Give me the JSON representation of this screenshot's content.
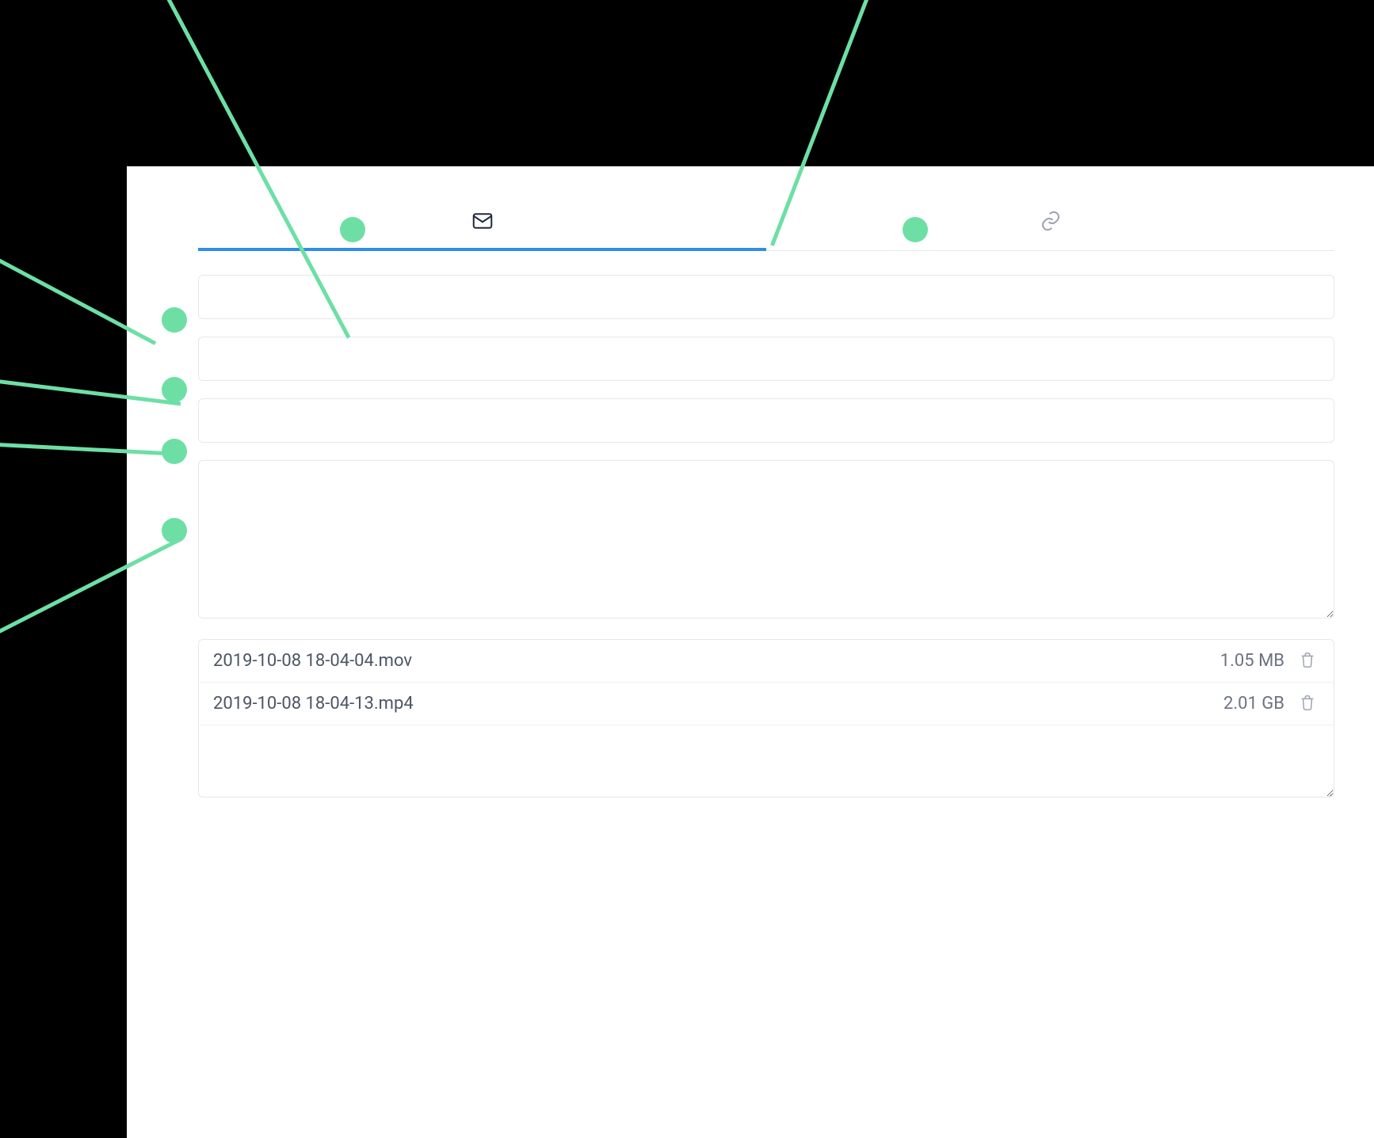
{
  "colors": {
    "accent_green": "#6ddfa5",
    "tab_active_blue": "#2f8ee8",
    "border_gray": "#e5e7eb",
    "icon_muted": "#9ca3af",
    "text_body": "#4b5563"
  },
  "tabs": {
    "email": {
      "icon": "envelope-icon",
      "active": true
    },
    "link": {
      "icon": "link-icon",
      "active": false
    }
  },
  "fields": {
    "input1": {
      "value": "",
      "placeholder": ""
    },
    "input2": {
      "value": "",
      "placeholder": ""
    },
    "input3": {
      "value": "",
      "placeholder": ""
    },
    "message": {
      "value": "",
      "placeholder": ""
    }
  },
  "files": [
    {
      "name": "2019-10-08 18-04-04.mov",
      "size": "1.05 MB"
    },
    {
      "name": "2019-10-08 18-04-13.mp4",
      "size": "2.01 GB"
    }
  ],
  "annotations": [
    {
      "target": "tab-email"
    },
    {
      "target": "tab-link"
    },
    {
      "target": "input1"
    },
    {
      "target": "input2"
    },
    {
      "target": "input3"
    },
    {
      "target": "message"
    }
  ]
}
